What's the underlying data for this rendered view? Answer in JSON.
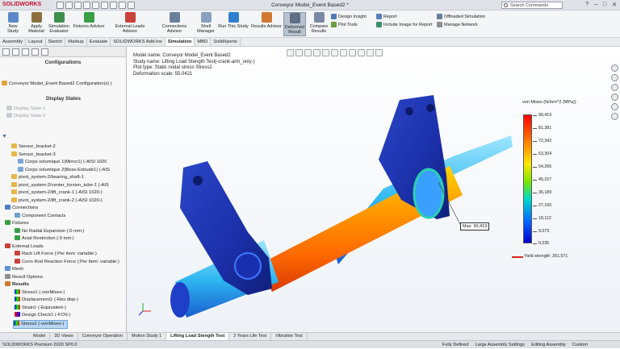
{
  "app": {
    "logo": "SOLIDWORKS",
    "window_title": "Conveyor Model_Event Based2 *",
    "search_placeholder": "Search Commands",
    "window_buttons": [
      "?",
      "–",
      "□",
      "✕"
    ]
  },
  "ribbon": {
    "buttons": [
      "New Study",
      "Apply Material",
      "Simulation Evaluator",
      "Fixtures Advisor",
      "External Loads Advisor",
      "Connections Advisor",
      "Shell Manager",
      "Run This Study",
      "Results Advisor",
      "Deformed Result",
      "Compare Results"
    ],
    "small": [
      "Design Insight",
      "Plot Tools",
      "Report",
      "Include Image for Report",
      "Offloaded Simulation",
      "Manage Network"
    ]
  },
  "tabs": [
    "Assembly",
    "Layout",
    "Sketch",
    "Markup",
    "Evaluate",
    "SOLIDWORKS Add-Ins",
    "Simulation",
    "MBD",
    "SolidXperts"
  ],
  "panel": {
    "configurations": "Configurations",
    "config_item": "Conveyor Model_Event Based2 Configuration(s) (",
    "display_states": "Display States",
    "ds": [
      "Display State-1",
      "Display State-2"
    ],
    "tree": [
      "Sensor_bracket-2",
      "Sensor_bracket-3",
      "Corps volumique 1(Mirror1) (-AISI 1020",
      "Corps volumique 2(Boss-Extrude1) (-AIS",
      "pivot_system-2/bearing_shaft-1",
      "pivot_system-2/center_torsion_tube-1 (-AIS",
      "pivot_system-2/lift_crank-1 (-AISI 1020-)",
      "pivot_system-2/lift_crank-2 (-AISI 1020-)",
      "Connections",
      "Component Contacts",
      "Fixtures",
      "No Radial Expansion (:0 mm:)",
      "Axial Restriction (:0 mm:)",
      "External Loads",
      "Rack Lift Force (:Per item: variable:)",
      "Conn Rod Reaction Force (:Per item: variable:)",
      "Mesh",
      "Result Options",
      "Results",
      "Stress1 (-vonMises-)",
      "Displacement1 (-Res disp-)",
      "Strain1 (-Equivalent-)",
      "Design Check1 (-FOS-)",
      "Stress2 (-vonMises-)"
    ]
  },
  "viewport": {
    "info": [
      "Model name: Conveyor Model_Event Based2",
      "Study name: Lifting Load Stength Test(-crank-arm_only-)",
      "Plot type: Static nodal stress Stress2",
      "Deformation scale: 55.0421"
    ],
    "legend_title": "von Mises (N/mm^2 (MPa))",
    "legend_ticks": [
      "90,419",
      "81,381",
      "72,342",
      "63,304",
      "54,265",
      "45,227",
      "36,189",
      "27,150",
      "18,112",
      "9,073",
      "0,035"
    ],
    "yield_label": "Yield strength: 351,571",
    "max_label": "Max: 90,419"
  },
  "bottom_tabs": [
    "Model",
    "3D Views",
    "Conveyor Operation",
    "Motion Study 1",
    "Lifting Load Stength Test",
    "2 Years Life Test",
    "Vibration Test"
  ],
  "status": {
    "left": "SOLIDWORKS Premium 2020 SP0.0",
    "right": [
      "Fully Defined",
      "Large Assembly Settings",
      "Editing Assembly",
      "Custom"
    ]
  }
}
